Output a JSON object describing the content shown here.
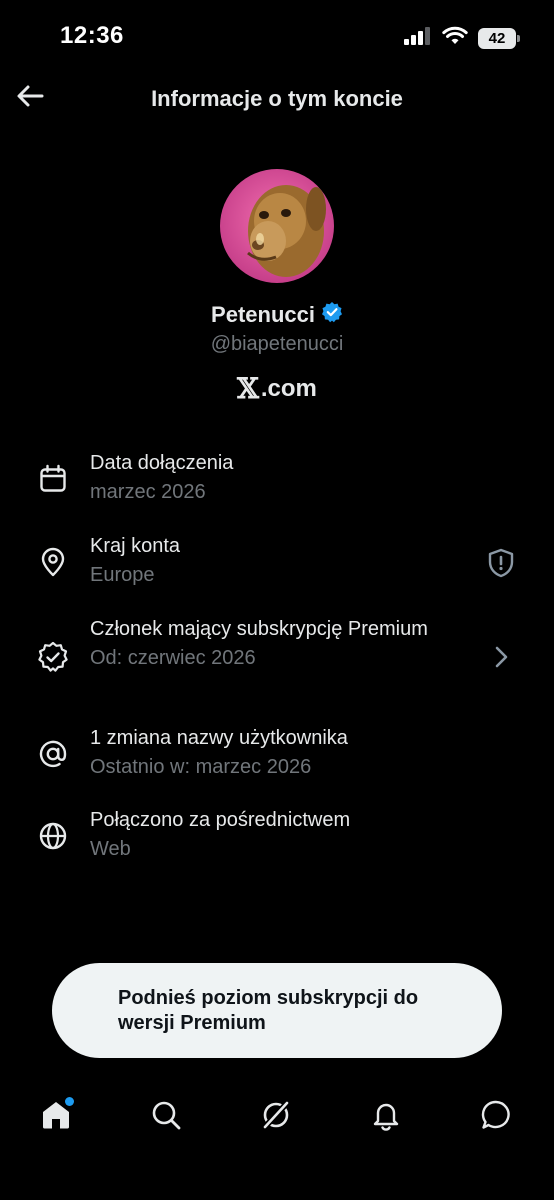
{
  "status_bar": {
    "time": "12:36",
    "battery_level": "42",
    "icons": [
      "cellular-signal-icon",
      "wifi-icon",
      "battery-icon"
    ]
  },
  "header": {
    "title": "Informacje o tym koncie",
    "back_icon": "arrow-left-icon"
  },
  "profile": {
    "display_name": "Petenucci",
    "handle": "@biapetenucci",
    "verified_badge": "verified-badge-icon",
    "site_mark": "𝕏",
    "site_text": ".com",
    "avatar_description": "profile picture"
  },
  "info_items": [
    {
      "icon": "calendar-icon",
      "title": "Data dołączenia",
      "subtitle": "marzec 2026"
    },
    {
      "icon": "location-pin-icon",
      "title": "Kraj konta",
      "subtitle": "Europe",
      "trailing_icon": "shield-icon"
    },
    {
      "icon": "verified-check-icon",
      "title": "Członek mający subskrypcję Premium",
      "subtitle": "Od: czerwiec 2026",
      "trailing_icon": "chevron-right-icon"
    },
    {
      "icon": "at-sign-icon",
      "title": "1 zmiana nazwy użytkownika",
      "subtitle": "Ostatnio w: marzec 2026"
    },
    {
      "icon": "globe-icon",
      "title": "Połączono za pośrednictwem",
      "subtitle": "Web"
    }
  ],
  "toast": {
    "text": "Podnieś poziom subskrypcji do wersji Premium"
  },
  "bottom_nav": {
    "items": [
      {
        "name": "home",
        "icon": "home-icon",
        "active": true,
        "has_notification_dot": true
      },
      {
        "name": "search",
        "icon": "search-icon"
      },
      {
        "name": "grok",
        "icon": "grok-icon"
      },
      {
        "name": "notifications",
        "icon": "bell-icon"
      },
      {
        "name": "messages",
        "icon": "message-bubble-icon"
      }
    ]
  },
  "colors": {
    "background": "#000000",
    "primary_text": "#e7e9ea",
    "secondary_text": "#71767b",
    "accent": "#1d9bf0",
    "toast_background": "#eff3f4"
  }
}
